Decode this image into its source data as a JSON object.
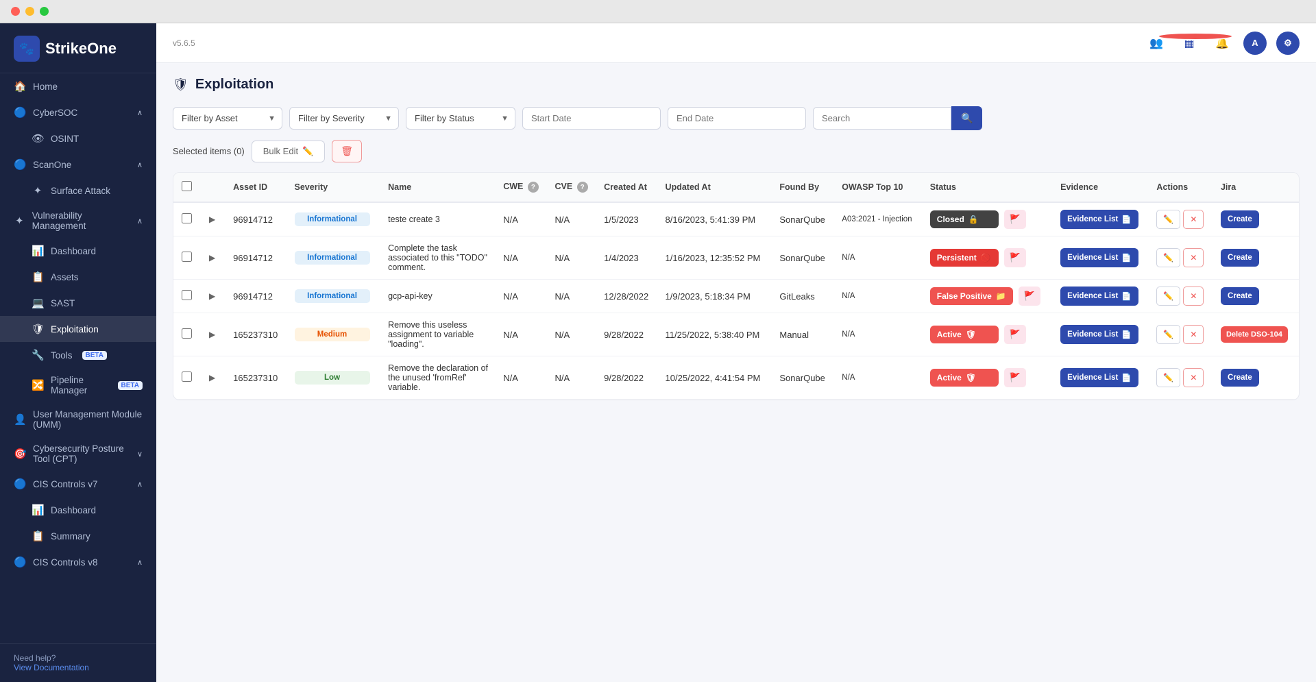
{
  "app": {
    "name": "StrikeOne",
    "version": "v5.6.5"
  },
  "sidebar": {
    "sections": [
      {
        "items": [
          {
            "id": "home",
            "label": "Home",
            "icon": "🏠",
            "level": 0
          }
        ]
      },
      {
        "items": [
          {
            "id": "cybersoc",
            "label": "CyberSOC",
            "icon": "🔵",
            "level": 0,
            "expandable": true
          },
          {
            "id": "osint",
            "label": "OSINT",
            "icon": "👁",
            "level": 1
          }
        ]
      },
      {
        "items": [
          {
            "id": "scanone",
            "label": "ScanOne",
            "icon": "🔵",
            "level": 0,
            "expandable": true
          },
          {
            "id": "surface-attack",
            "label": "Surface Attack",
            "icon": "✦",
            "level": 1
          }
        ]
      },
      {
        "items": [
          {
            "id": "vuln-mgmt",
            "label": "Vulnerability Management",
            "icon": "✦",
            "level": 0,
            "expandable": true
          },
          {
            "id": "dashboard",
            "label": "Dashboard",
            "icon": "📊",
            "level": 1
          },
          {
            "id": "assets",
            "label": "Assets",
            "icon": "📋",
            "level": 1
          },
          {
            "id": "sast",
            "label": "SAST",
            "icon": "💻",
            "level": 1
          },
          {
            "id": "exploitation",
            "label": "Exploitation",
            "icon": "🛡",
            "level": 1,
            "active": true
          },
          {
            "id": "tools",
            "label": "Tools",
            "icon": "🔧",
            "level": 1,
            "badge": "BETA"
          },
          {
            "id": "pipeline",
            "label": "Pipeline Manager",
            "icon": "🔀",
            "level": 1,
            "badge": "BETA"
          }
        ]
      },
      {
        "items": [
          {
            "id": "umm",
            "label": "User Management Module (UMM)",
            "icon": "👤",
            "level": 0
          }
        ]
      },
      {
        "items": [
          {
            "id": "cpt",
            "label": "Cybersecurity Posture Tool (CPT)",
            "icon": "🎯",
            "level": 0,
            "expandable": true
          }
        ]
      },
      {
        "items": [
          {
            "id": "cis-v7",
            "label": "CIS Controls v7",
            "icon": "🔵",
            "level": 0,
            "expandable": true
          },
          {
            "id": "cis-dashboard",
            "label": "Dashboard",
            "icon": "📊",
            "level": 1
          },
          {
            "id": "cis-summary",
            "label": "Summary",
            "icon": "📋",
            "level": 1
          }
        ]
      },
      {
        "items": [
          {
            "id": "cis-v8",
            "label": "CIS Controls v8",
            "icon": "🔵",
            "level": 0,
            "expandable": true
          }
        ]
      }
    ],
    "footer": {
      "help_label": "Need help?",
      "docs_label": "View Documentation"
    }
  },
  "topbar": {
    "version": "v5.6.5"
  },
  "page": {
    "title": "Exploitation",
    "filters": {
      "asset_placeholder": "Filter by Asset",
      "severity_placeholder": "Filter by Severity",
      "status_placeholder": "Filter by Status",
      "start_date_placeholder": "Start Date",
      "end_date_placeholder": "End Date",
      "search_placeholder": "Search"
    },
    "bulk": {
      "selected_label": "Selected items (0)",
      "edit_label": "Bulk Edit",
      "delete_icon": "🗑"
    },
    "table": {
      "columns": [
        "",
        "",
        "Asset ID",
        "Severity",
        "Name",
        "CWE",
        "CVE",
        "Created At",
        "Updated At",
        "Found By",
        "OWASP Top 10",
        "Status",
        "Evidence",
        "Actions",
        "Jira"
      ],
      "rows": [
        {
          "id": "row1",
          "asset_id": "96914712",
          "severity": "Informational",
          "severity_type": "informational",
          "name": "teste create 3",
          "cwe": "N/A",
          "cve": "N/A",
          "created_at": "1/5/2023",
          "updated_at": "8/16/2023, 5:41:39 PM",
          "found_by": "SonarQube",
          "owasp": "A03:2021 - Injection",
          "status": "Closed",
          "status_type": "closed",
          "evidence_label": "Evidence List",
          "jira_label": "Create"
        },
        {
          "id": "row2",
          "asset_id": "96914712",
          "severity": "Informational",
          "severity_type": "informational",
          "name": "Complete the task associated to this \"TODO\" comment.",
          "cwe": "N/A",
          "cve": "N/A",
          "created_at": "1/4/2023",
          "updated_at": "1/16/2023, 12:35:52 PM",
          "found_by": "SonarQube",
          "owasp": "N/A",
          "status": "Persistent",
          "status_type": "persistent",
          "evidence_label": "Evidence List",
          "jira_label": "Create"
        },
        {
          "id": "row3",
          "asset_id": "96914712",
          "severity": "Informational",
          "severity_type": "informational",
          "name": "gcp-api-key",
          "cwe": "N/A",
          "cve": "N/A",
          "created_at": "12/28/2022",
          "updated_at": "1/9/2023, 5:18:34 PM",
          "found_by": "GitLeaks",
          "owasp": "N/A",
          "status": "False Positive",
          "status_type": "false-positive",
          "evidence_label": "Evidence List",
          "jira_label": "Create"
        },
        {
          "id": "row4",
          "asset_id": "165237310",
          "severity": "Medium",
          "severity_type": "medium",
          "name": "Remove this useless assignment to variable \"loading\".",
          "cwe": "N/A",
          "cve": "N/A",
          "created_at": "9/28/2022",
          "updated_at": "11/25/2022, 5:38:40 PM",
          "found_by": "Manual",
          "owasp": "N/A",
          "status": "Active",
          "status_type": "active",
          "evidence_label": "Evidence List",
          "jira_label": "Delete DSO-104"
        },
        {
          "id": "row5",
          "asset_id": "165237310",
          "severity": "Low",
          "severity_type": "low",
          "name": "Remove the declaration of the unused 'fromRef' variable.",
          "cwe": "N/A",
          "cve": "N/A",
          "created_at": "9/28/2022",
          "updated_at": "10/25/2022, 4:41:54 PM",
          "found_by": "SonarQube",
          "owasp": "N/A",
          "status": "Active",
          "status_type": "active",
          "evidence_label": "Evidence List",
          "jira_label": "Create"
        }
      ]
    }
  }
}
